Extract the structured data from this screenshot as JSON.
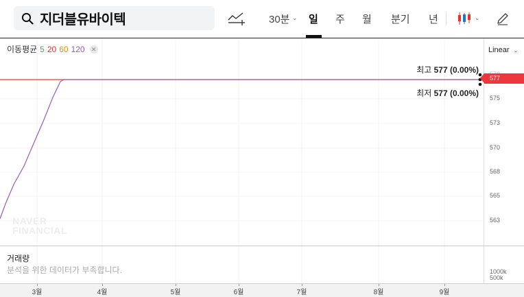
{
  "search": {
    "query": "지더블유바이텍"
  },
  "toolbar": {
    "indicator_icon": "trend-line-add-icon",
    "interval_label": "30분",
    "periods": [
      "일",
      "주",
      "월",
      "분기",
      "년"
    ],
    "active_period": "일",
    "chart_type_icon": "candlestick-icon",
    "draw_icon": "pencil-icon"
  },
  "chart": {
    "ma_legend": {
      "label": "이동평균",
      "periods": [
        "5",
        "20",
        "60",
        "120"
      ],
      "colors": [
        "#3cb44b",
        "#e6332a",
        "#f08c00",
        "#9b59b6"
      ]
    },
    "scale": "Linear",
    "high": {
      "label": "최고",
      "value": "577 (0.00%)"
    },
    "low": {
      "label": "최저",
      "value": "577 (0.00%)"
    },
    "current_price": "577",
    "price_color": "#f0363d",
    "y_ticks": [
      "578",
      "575",
      "573",
      "570",
      "568",
      "565",
      "563"
    ],
    "watermark": [
      "NAVER",
      "FINANCIAL"
    ]
  },
  "volume": {
    "title": "거래량",
    "message": "분석을 위한 데이터가 부족합니다.",
    "ticks": [
      "1000k",
      "500k"
    ]
  },
  "x_axis": [
    "3월",
    "4월",
    "5월",
    "6월",
    "7월",
    "8월",
    "9월"
  ]
}
